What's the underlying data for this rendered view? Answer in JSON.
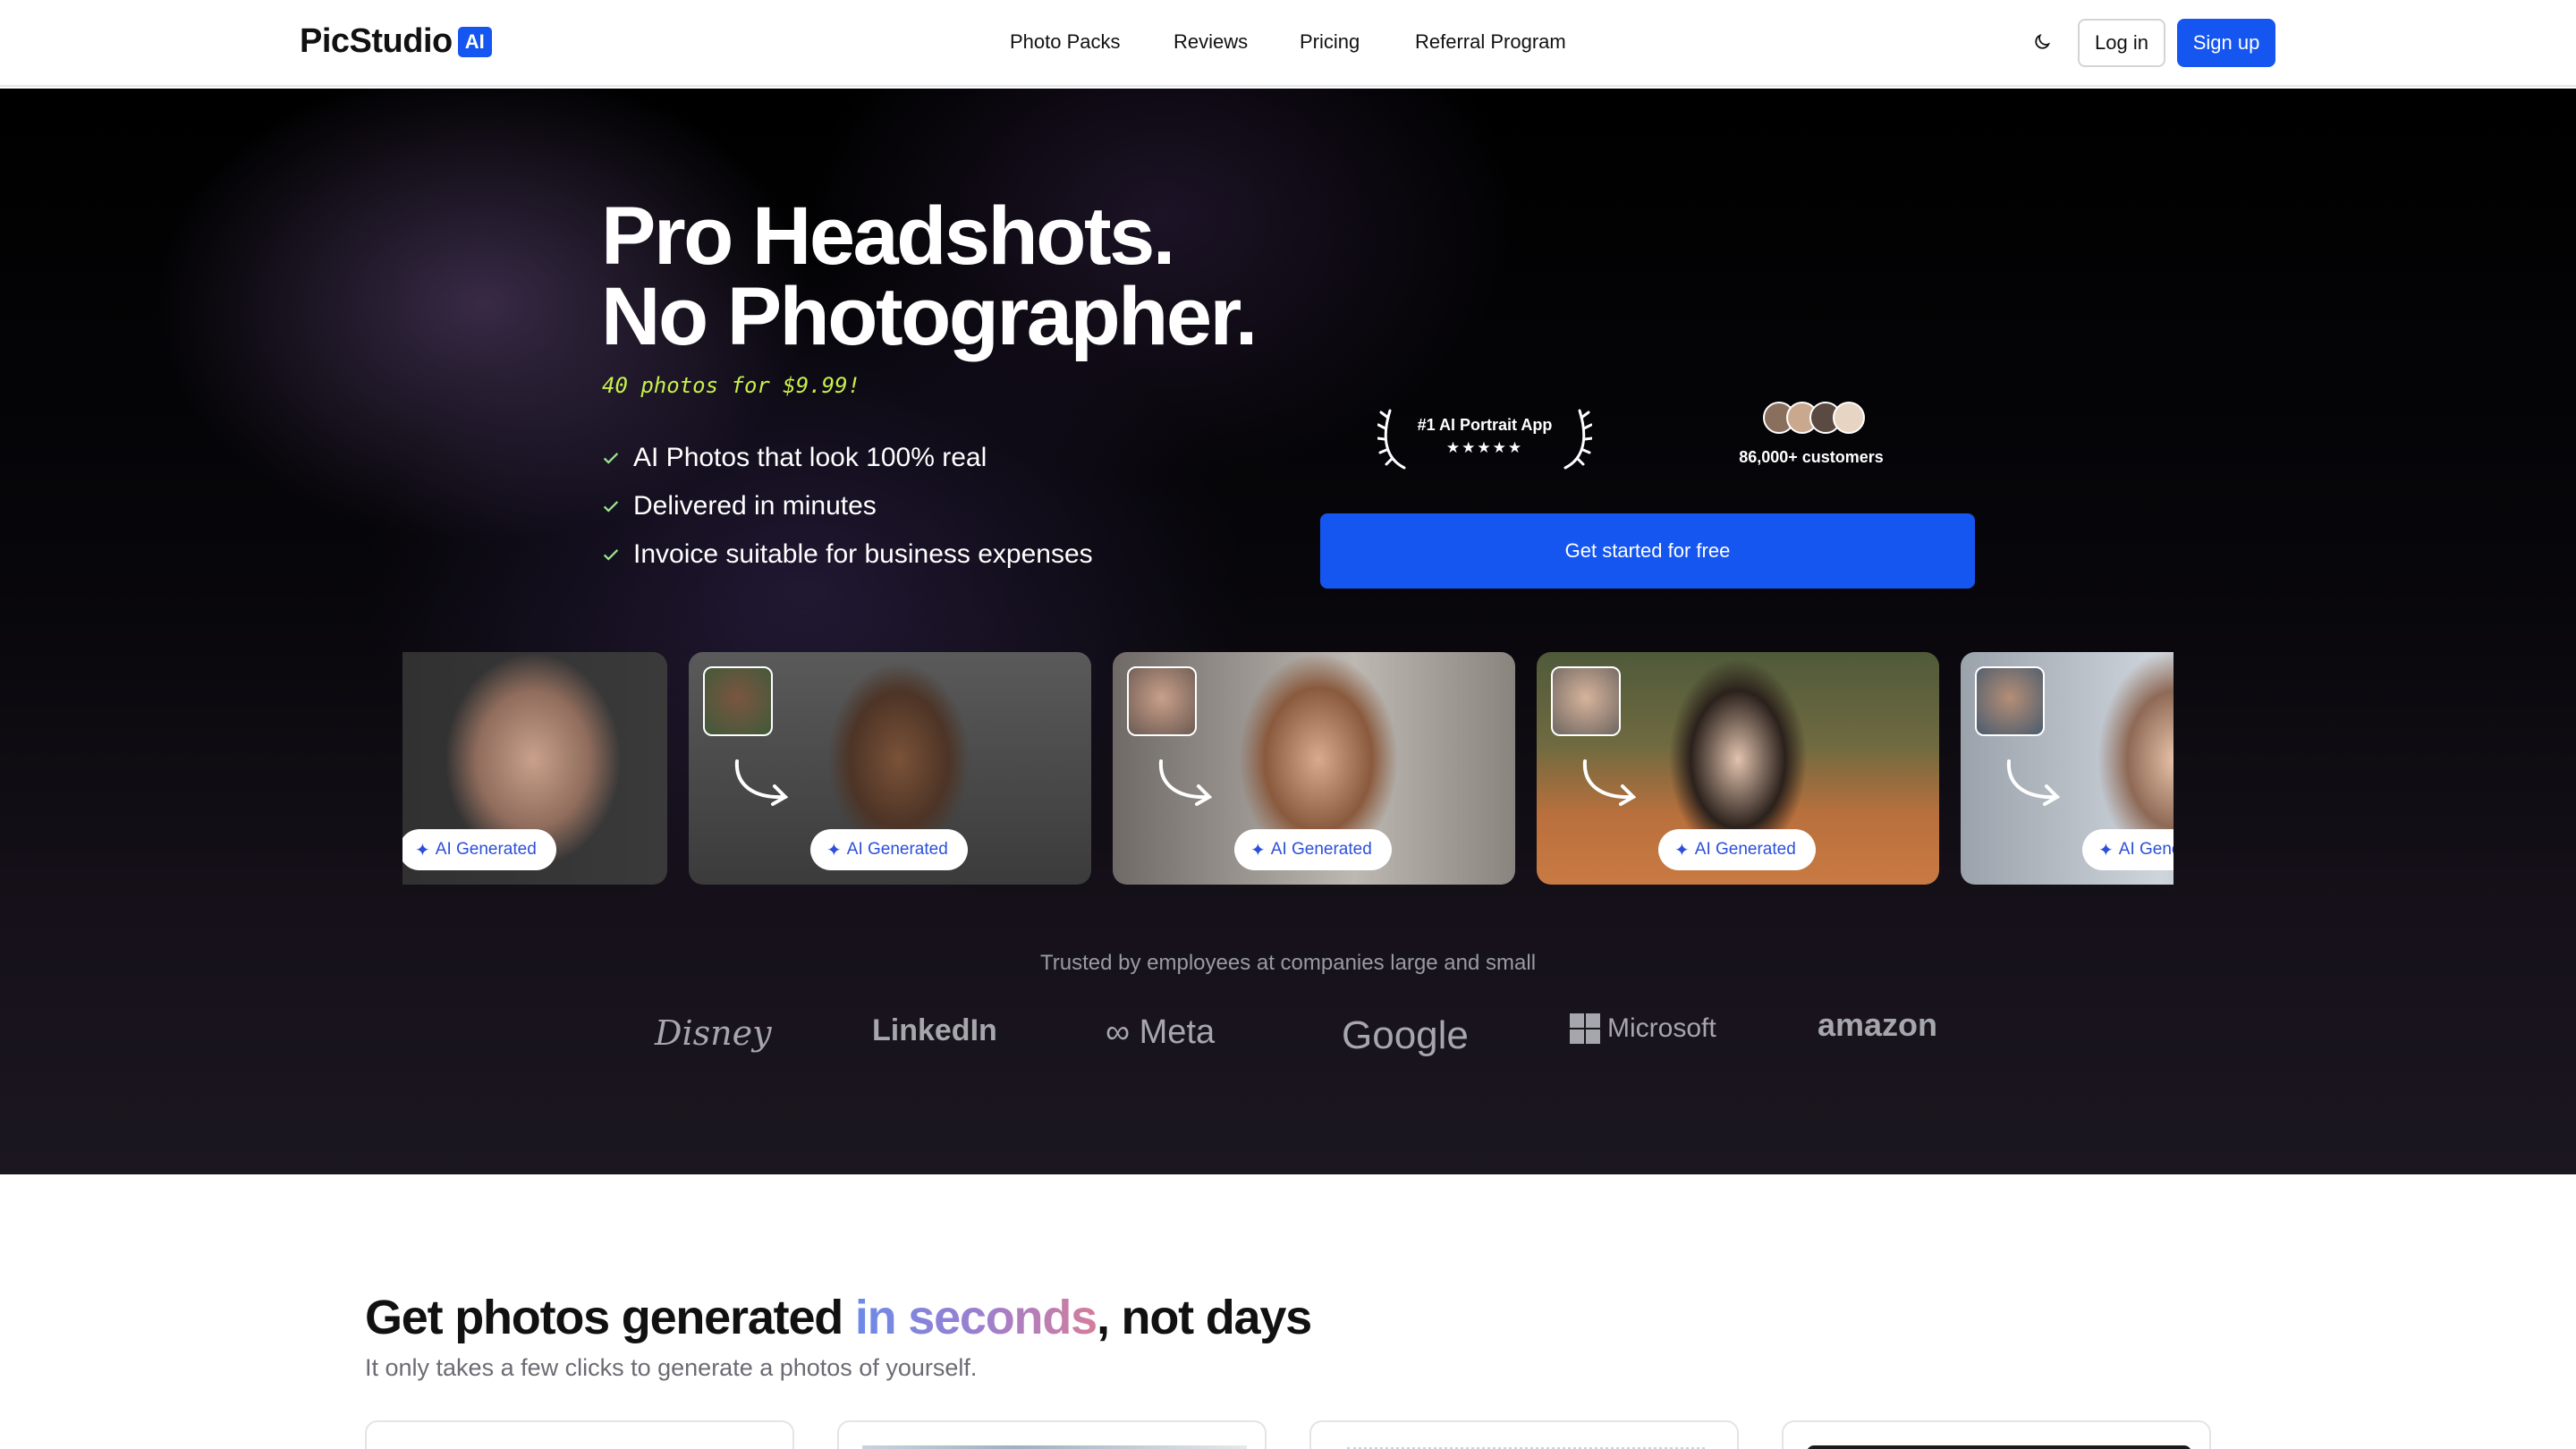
{
  "nav": {
    "logo_text": "PicStudio",
    "logo_badge": "AI",
    "links": [
      "Photo Packs",
      "Reviews",
      "Pricing",
      "Referral Program"
    ],
    "theme_icon": "moon-icon",
    "login_label": "Log in",
    "signup_label": "Sign up"
  },
  "hero": {
    "title_line1": "Pro Headshots.",
    "title_line2": "No Photographer.",
    "price_note": "40 photos for $9.99!",
    "features": [
      "AI Photos that look 100% real",
      "Delivered in minutes",
      "Invoice suitable for business expenses"
    ],
    "award_label": "#1 AI Portrait App",
    "award_stars": "★★★★★",
    "customers_label": "86,000+ customers",
    "cta_label": "Get started for free",
    "ai_badge_label": "AI Generated",
    "trusted_text": "Trusted by employees at companies large and small",
    "brands": [
      "Disney",
      "LinkedIn",
      "Meta",
      "Google",
      "Microsoft",
      "amazon"
    ]
  },
  "section2": {
    "title_before": "Get photos generated ",
    "title_highlight": "in seconds",
    "title_after": ", not days",
    "subtitle": "It only takes a few clicks to generate a photos of yourself."
  },
  "colors": {
    "brand_blue": "#1556f0",
    "price_note": "#c8f04a",
    "hero_bg": "#000000",
    "title_gradient": [
      "#6b8be8",
      "#9a7fd0",
      "#d47d9c"
    ]
  }
}
